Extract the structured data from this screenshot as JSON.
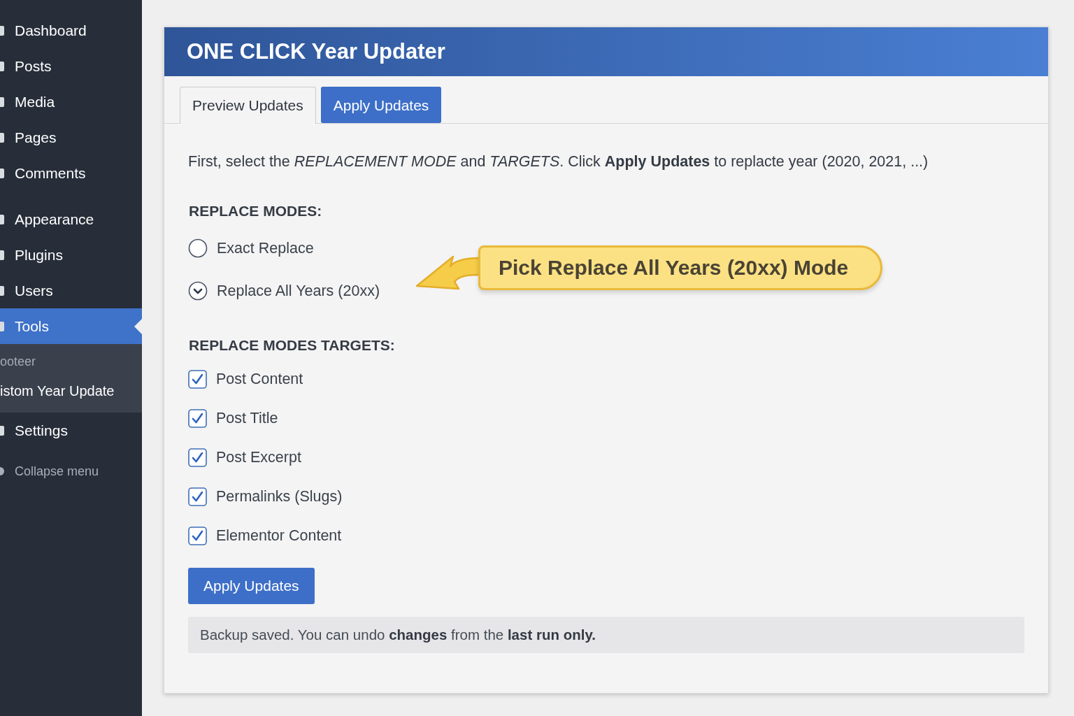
{
  "sidebar": {
    "groups": [
      {
        "items": [
          {
            "label": "Dashboard",
            "selected": false
          },
          {
            "label": "Posts",
            "selected": false
          },
          {
            "label": "Media",
            "selected": false
          },
          {
            "label": "Pages",
            "selected": false
          },
          {
            "label": "Comments",
            "selected": false
          }
        ]
      },
      {
        "items": [
          {
            "label": "Appearance",
            "selected": false
          },
          {
            "label": "Plugins",
            "selected": false
          },
          {
            "label": "Users",
            "selected": false
          },
          {
            "label": "Tools",
            "selected": true,
            "children": [
              {
                "label": "ooteer",
                "selected": false
              },
              {
                "label": "istom Year Update",
                "selected": true
              }
            ]
          },
          {
            "label": "Settings",
            "selected": false
          }
        ]
      }
    ],
    "collapse": "Collapse menu"
  },
  "panel": {
    "title": "ONE CLICK Year Updater",
    "tabs": [
      {
        "label": "Preview Updates",
        "selected": true
      },
      {
        "label": "Apply Updates",
        "selected": false
      }
    ],
    "intro": "First, select the *REPLACEMENT MODE* and *TARGETS*. Click **Apply Updates** to replacte year (2020, 2021, ...)",
    "modes_heading": "REPLACE MODES:",
    "modes": [
      {
        "label": "Exact Replace",
        "selected": false
      },
      {
        "label": "Replace All Years (20xx)",
        "selected": true
      }
    ],
    "callout": "Pick Replace All Years (20xx) Mode",
    "targets_heading": "REPLACE MODES TARGETS:",
    "targets": [
      {
        "label": "Post Content",
        "checked": true
      },
      {
        "label": "Post Title",
        "checked": true
      },
      {
        "label": "Post Excerpt",
        "checked": true
      },
      {
        "label": "Permalinks (Slugs)",
        "checked": true
      },
      {
        "label": "Elementor Content",
        "checked": true
      }
    ],
    "button": "Apply Updates",
    "notice": "Backup saved. You can undo **changes** from the **last run only.**"
  }
}
